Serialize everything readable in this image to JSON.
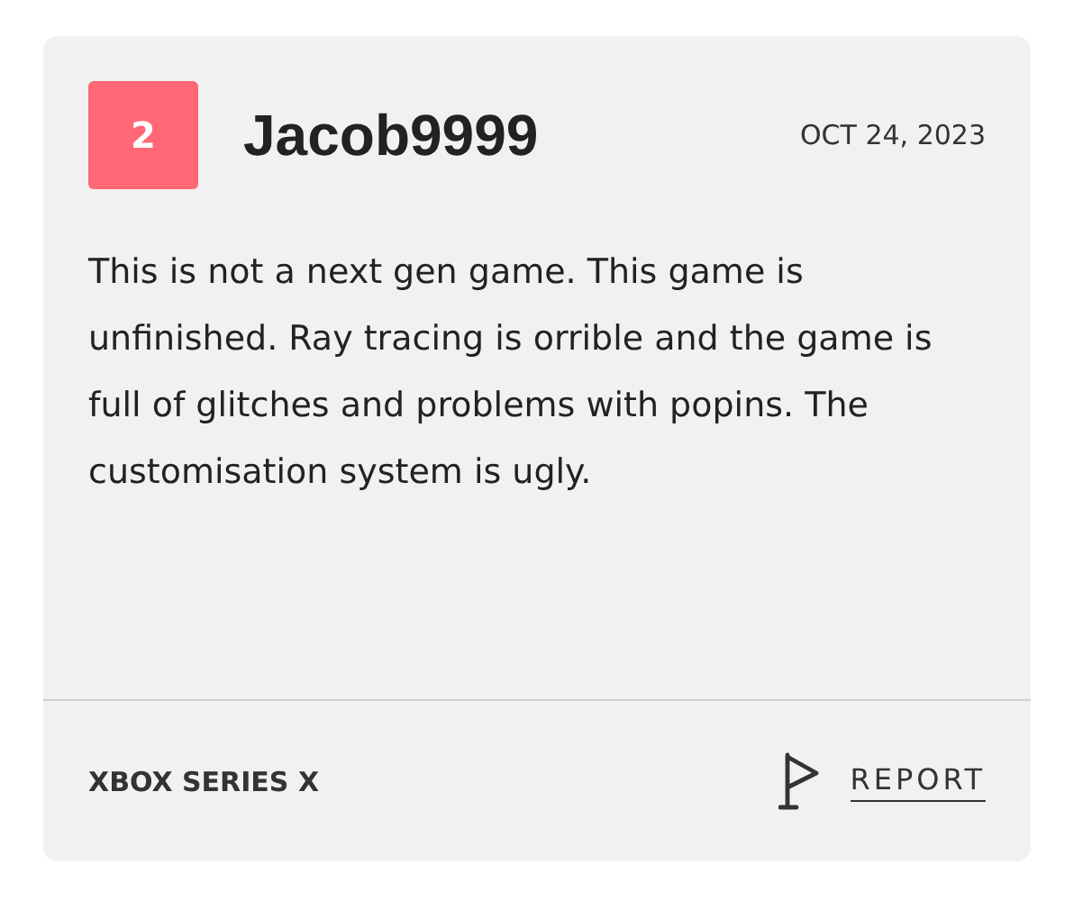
{
  "review": {
    "score": "2",
    "username": "Jacob9999",
    "date": "OCT 24, 2023",
    "text": "This is not a next gen game. This game is unfinished. Ray tracing is orrible and the game is full of glitches and problems with popins. The customisation system is ugly.",
    "platform": "XBOX SERIES X",
    "report": "REPORT"
  }
}
